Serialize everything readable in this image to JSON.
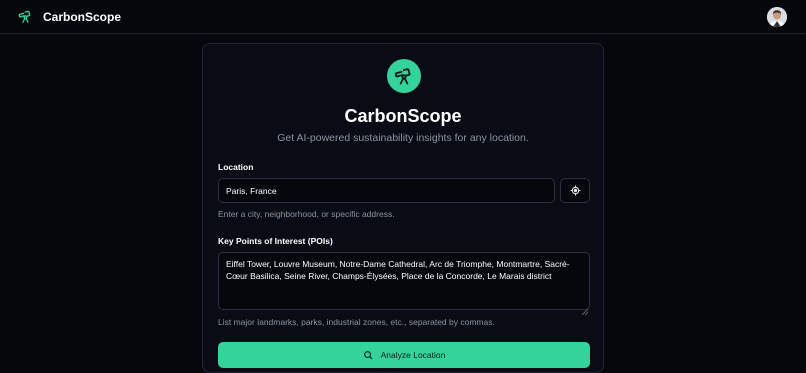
{
  "header": {
    "brand_name": "CarbonScope",
    "brand_icon": "telescope-icon",
    "avatar_icon": "user-avatar"
  },
  "card": {
    "logo_icon": "telescope-icon",
    "title": "CarbonScope",
    "subtitle": "Get AI-powered sustainability insights for any location."
  },
  "location": {
    "label": "Location",
    "value": "Paris, France",
    "locate_icon": "crosshair-icon",
    "hint": "Enter a city, neighborhood, or specific address."
  },
  "poi": {
    "label": "Key Points of Interest (POIs)",
    "value": "Eiffel Tower, Louvre Museum, Notre-Dame Cathedral, Arc de Triomphe, Montmartre, Sacré-Cœur Basilica, Seine River, Champs-Élysées, Place de la Concorde, Le Marais district",
    "hint": "List major landmarks, parks, industrial zones, etc., separated by commas."
  },
  "actions": {
    "analyze_label": "Analyze Location",
    "analyze_icon": "search-icon"
  },
  "colors": {
    "accent": "#34d399",
    "background": "#05070d",
    "card_border": "#20263a",
    "muted_text": "#8b93a6"
  }
}
